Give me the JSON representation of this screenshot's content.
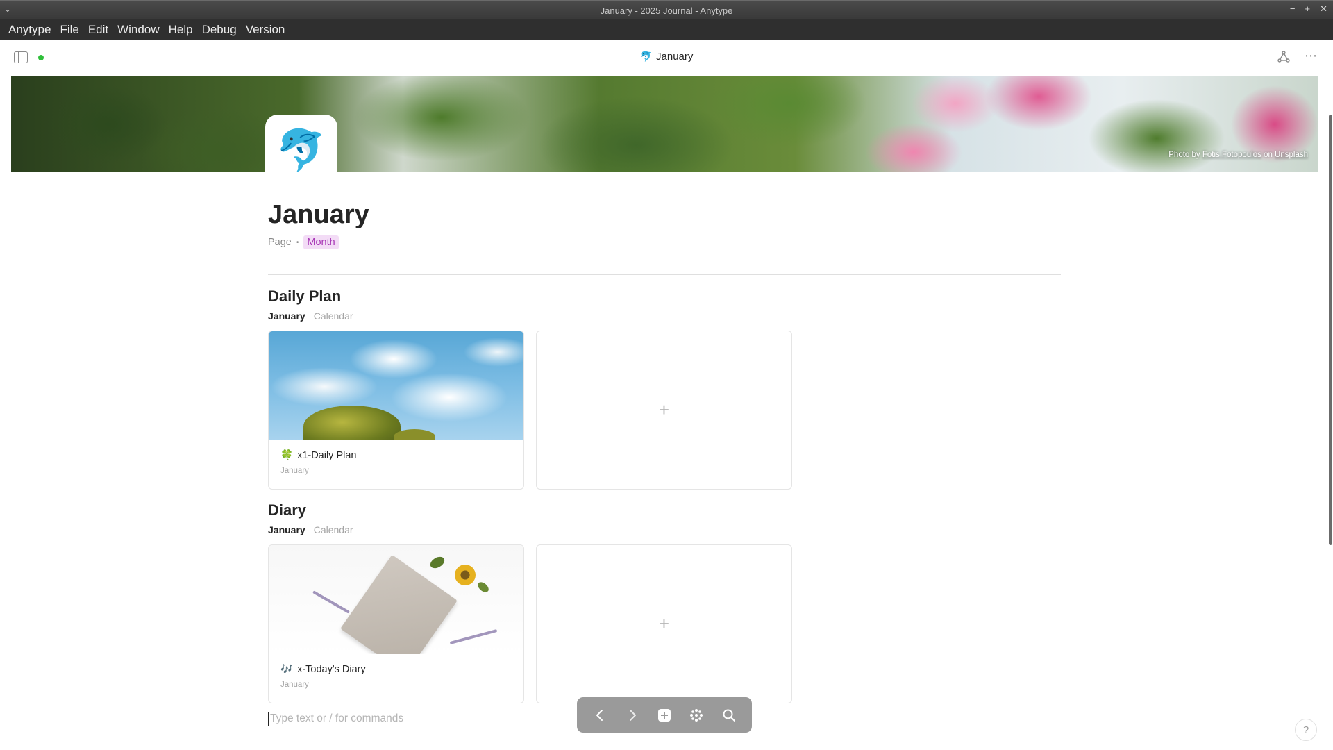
{
  "window": {
    "title": "January - 2025 Journal - Anytype",
    "collapse_glyph": "⌄",
    "controls": [
      "−",
      "+",
      "✕"
    ]
  },
  "menu": {
    "items": [
      "Anytype",
      "File",
      "Edit",
      "Window",
      "Help",
      "Debug",
      "Version"
    ]
  },
  "header": {
    "emoji": "🐬",
    "title": "January",
    "more_glyph": "⋯"
  },
  "cover": {
    "credit_prefix": "Photo by ",
    "credit_author": "Fotis Fotopoulos",
    "credit_middle": " on ",
    "credit_source": "Unsplash"
  },
  "page": {
    "icon": "🐬",
    "title": "January",
    "type": "Page",
    "separator": "•",
    "tag": "Month",
    "tag_color": "#a737b5",
    "tag_bg": "#f3dcf6"
  },
  "sets": [
    {
      "title": "Daily Plan",
      "tabs": [
        "January",
        "Calendar"
      ],
      "card": {
        "emoji": "🍀",
        "name": "x1-Daily Plan",
        "relation": "January"
      },
      "add_glyph": "+"
    },
    {
      "title": "Diary",
      "tabs": [
        "January",
        "Calendar"
      ],
      "card": {
        "emoji": "🎶",
        "name": "x-Today's Diary",
        "relation": "January"
      },
      "add_glyph": "+"
    }
  ],
  "editor": {
    "placeholder": "Type text or / for commands"
  },
  "navbar": {
    "back_glyph": "‹",
    "forward_glyph": "›",
    "plus_glyph": "+",
    "search_glyph": "⌕"
  },
  "help": {
    "glyph": "?"
  },
  "colors": {
    "sync_dot": "#2fbf3a",
    "menubar_bg": "#2f2f2f",
    "navbar_bg": "#9a9a9a"
  }
}
